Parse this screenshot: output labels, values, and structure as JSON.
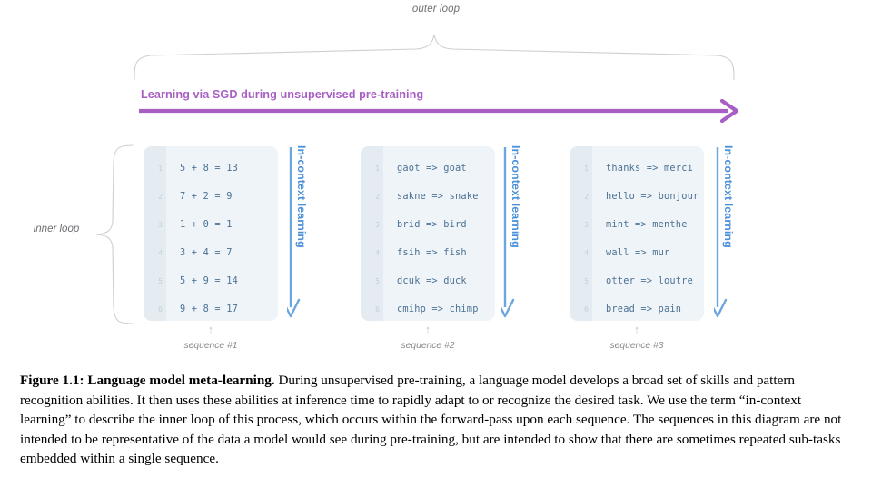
{
  "figure": {
    "outer_loop_label": "outer loop",
    "inner_loop_label": "inner loop",
    "sgd_title": "Learning via SGD during unsupervised pre-training",
    "icl_label": "In-context learning",
    "colors": {
      "sgd_purple": "#a85fc4",
      "icl_blue": "#4a90d9",
      "panel_background": "#eef4f8",
      "panel_gutter": "#e4ecf2",
      "code_text": "#4d7193",
      "line_number": "#c2ced6",
      "brace_gray": "#cfcfd3",
      "label_gray": "#6f6f74"
    },
    "sequences": [
      {
        "caption": "sequence #1",
        "lines": [
          {
            "n": "1",
            "code": "5 + 8 = 13"
          },
          {
            "n": "2",
            "code": "7 + 2 = 9"
          },
          {
            "n": "3",
            "code": "1 + 0 = 1"
          },
          {
            "n": "4",
            "code": "3 + 4 = 7"
          },
          {
            "n": "5",
            "code": "5 + 9 = 14"
          },
          {
            "n": "6",
            "code": "9 + 8 = 17"
          }
        ]
      },
      {
        "caption": "sequence #2",
        "lines": [
          {
            "n": "1",
            "code": "gaot => goat"
          },
          {
            "n": "2",
            "code": "sakne => snake"
          },
          {
            "n": "3",
            "code": "brid => bird"
          },
          {
            "n": "4",
            "code": "fsih => fish"
          },
          {
            "n": "5",
            "code": "dcuk => duck"
          },
          {
            "n": "6",
            "code": "cmihp => chimp"
          }
        ]
      },
      {
        "caption": "sequence #3",
        "lines": [
          {
            "n": "1",
            "code": "thanks => merci"
          },
          {
            "n": "2",
            "code": "hello => bonjour"
          },
          {
            "n": "3",
            "code": "mint => menthe"
          },
          {
            "n": "4",
            "code": "wall => mur"
          },
          {
            "n": "5",
            "code": "otter => loutre"
          },
          {
            "n": "6",
            "code": "bread => pain"
          }
        ]
      }
    ]
  },
  "caption": {
    "label": "Figure 1.1: Language model meta-learning.",
    "body": " During unsupervised pre-training, a language model develops a broad set of skills and pattern recognition abilities. It then uses these abilities at inference time to rapidly adapt to or recognize the desired task. We use the term “in-context learning” to describe the inner loop of this process, which occurs within the forward-pass upon each sequence. The sequences in this diagram are not intended to be representative of the data a model would see during pre-training, but are intended to show that there are sometimes repeated sub-tasks embedded within a single sequence."
  }
}
